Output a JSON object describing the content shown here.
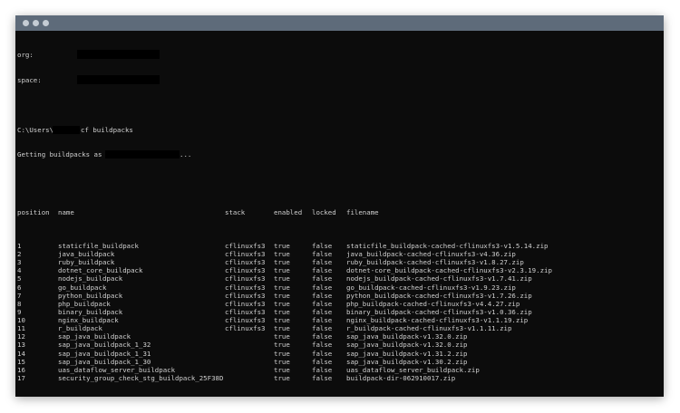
{
  "window": {
    "title": ""
  },
  "terminal": {
    "org_label": "org:",
    "space_label": "space:",
    "prompt": "C:\\Users\\",
    "command": "cf buildpacks",
    "getting_prefix": "Getting buildpacks as",
    "getting_suffix": "...",
    "headers": {
      "position": "position",
      "name": "name",
      "stack": "stack",
      "enabled": "enabled",
      "locked": "locked",
      "filename": "filename"
    },
    "rows": [
      {
        "position": "1",
        "name": "staticfile_buildpack",
        "stack": "cflinuxfs3",
        "enabled": "true",
        "locked": "false",
        "filename": "staticfile_buildpack-cached-cflinuxfs3-v1.5.14.zip"
      },
      {
        "position": "2",
        "name": "java_buildpack",
        "stack": "cflinuxfs3",
        "enabled": "true",
        "locked": "false",
        "filename": "java_buildpack-cached-cflinuxfs3-v4.36.zip"
      },
      {
        "position": "3",
        "name": "ruby_buildpack",
        "stack": "cflinuxfs3",
        "enabled": "true",
        "locked": "false",
        "filename": "ruby_buildpack-cached-cflinuxfs3-v1.8.27.zip"
      },
      {
        "position": "4",
        "name": "dotnet_core_buildpack",
        "stack": "cflinuxfs3",
        "enabled": "true",
        "locked": "false",
        "filename": "dotnet-core_buildpack-cached-cflinuxfs3-v2.3.19.zip"
      },
      {
        "position": "5",
        "name": "nodejs_buildpack",
        "stack": "cflinuxfs3",
        "enabled": "true",
        "locked": "false",
        "filename": "nodejs_buildpack-cached-cflinuxfs3-v1.7.41.zip"
      },
      {
        "position": "6",
        "name": "go_buildpack",
        "stack": "cflinuxfs3",
        "enabled": "true",
        "locked": "false",
        "filename": "go_buildpack-cached-cflinuxfs3-v1.9.23.zip"
      },
      {
        "position": "7",
        "name": "python_buildpack",
        "stack": "cflinuxfs3",
        "enabled": "true",
        "locked": "false",
        "filename": "python_buildpack-cached-cflinuxfs3-v1.7.26.zip"
      },
      {
        "position": "8",
        "name": "php_buildpack",
        "stack": "cflinuxfs3",
        "enabled": "true",
        "locked": "false",
        "filename": "php_buildpack-cached-cflinuxfs3-v4.4.27.zip"
      },
      {
        "position": "9",
        "name": "binary_buildpack",
        "stack": "cflinuxfs3",
        "enabled": "true",
        "locked": "false",
        "filename": "binary_buildpack-cached-cflinuxfs3-v1.0.36.zip"
      },
      {
        "position": "10",
        "name": "nginx_buildpack",
        "stack": "cflinuxfs3",
        "enabled": "true",
        "locked": "false",
        "filename": "nginx_buildpack-cached-cflinuxfs3-v1.1.19.zip"
      },
      {
        "position": "11",
        "name": "r_buildpack",
        "stack": "cflinuxfs3",
        "enabled": "true",
        "locked": "false",
        "filename": "r_buildpack-cached-cflinuxfs3-v1.1.11.zip"
      },
      {
        "position": "12",
        "name": "sap_java_buildpack",
        "stack": "",
        "enabled": "true",
        "locked": "false",
        "filename": "sap_java_buildpack-v1.32.0.zip"
      },
      {
        "position": "13",
        "name": "sap_java_buildpack_1_32",
        "stack": "",
        "enabled": "true",
        "locked": "false",
        "filename": "sap_java_buildpack-v1.32.0.zip"
      },
      {
        "position": "14",
        "name": "sap_java_buildpack_1_31",
        "stack": "",
        "enabled": "true",
        "locked": "false",
        "filename": "sap_java_buildpack-v1.31.2.zip"
      },
      {
        "position": "15",
        "name": "sap_java_buildpack_1_30",
        "stack": "",
        "enabled": "true",
        "locked": "false",
        "filename": "sap_java_buildpack-v1.30.2.zip"
      },
      {
        "position": "16",
        "name": "uas_dataflow_server_buildpack",
        "stack": "",
        "enabled": "true",
        "locked": "false",
        "filename": "uas_dataflow_server_buildpack.zip"
      },
      {
        "position": "17",
        "name": "security_group_check_stg_buildpack_25F38D",
        "stack": "",
        "enabled": "true",
        "locked": "false",
        "filename": "buildpack-dir-062910017.zip"
      }
    ]
  },
  "colors": {
    "terminal_bg": "#0c0c0c",
    "terminal_text": "#d0d0d0",
    "titlebar": "#5e6b7a"
  }
}
